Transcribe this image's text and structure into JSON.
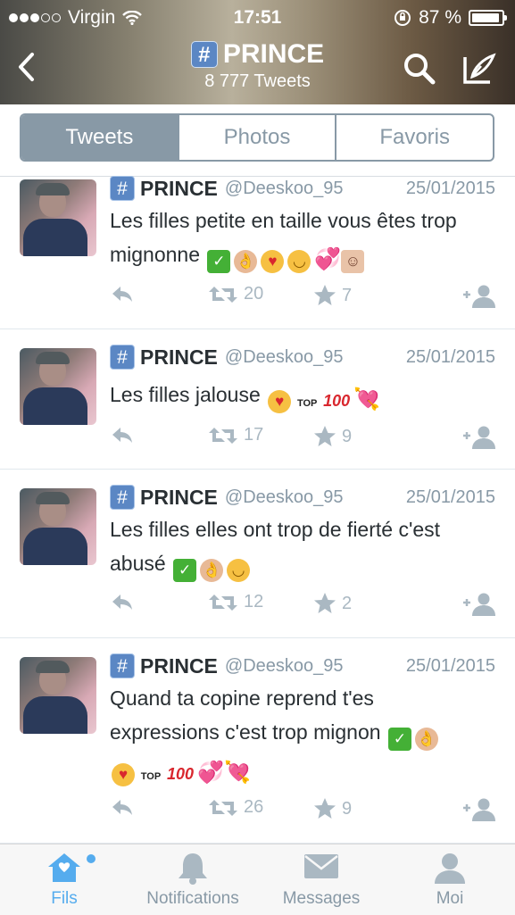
{
  "status_bar": {
    "carrier": "Virgin",
    "time": "17:51",
    "battery": "87 %"
  },
  "header": {
    "title": "PRINCE",
    "hashtag_symbol": "#",
    "subtitle": "8 777 Tweets"
  },
  "segments": [
    {
      "label": "Tweets",
      "active": true
    },
    {
      "label": "Photos",
      "active": false
    },
    {
      "label": "Favoris",
      "active": false
    }
  ],
  "tweets": [
    {
      "name": "PRINCE",
      "handle": "@Deeskoo_95",
      "date": "25/01/2015",
      "text_line1": "Les filles petite en taille vous êtes trop",
      "text_line2": "mignonne",
      "emoji": [
        "check",
        "ok-hand",
        "heart-eyes",
        "relieved",
        "two-hearts",
        "couple"
      ],
      "retweets": "20",
      "favorites": "7"
    },
    {
      "name": "PRINCE",
      "handle": "@Deeskoo_95",
      "date": "25/01/2015",
      "text_line1": "Les filles jalouse",
      "emoji": [
        "heart-eyes",
        "top",
        "hundred",
        "heart-arrow"
      ],
      "retweets": "17",
      "favorites": "9"
    },
    {
      "name": "PRINCE",
      "handle": "@Deeskoo_95",
      "date": "25/01/2015",
      "text_line1": "Les filles elles ont trop de fierté c'est",
      "text_line2": "abusé",
      "emoji": [
        "check",
        "ok-hand",
        "smirk"
      ],
      "retweets": "12",
      "favorites": "2"
    },
    {
      "name": "PRINCE",
      "handle": "@Deeskoo_95",
      "date": "25/01/2015",
      "text_line1": "Quand ta copine reprend t'es",
      "text_line2": "expressions c'est trop mignon",
      "emoji": [
        "check",
        "ok-hand",
        "heart-eyes",
        "top",
        "hundred",
        "two-hearts",
        "heart-arrow"
      ],
      "retweets": "26",
      "favorites": "9"
    }
  ],
  "emoji_glyphs": {
    "check": "✓",
    "top": "TOP",
    "hundred": "100",
    "hearts": "💞",
    "arrow_heart": "💘"
  },
  "tabbar": [
    {
      "label": "Fils",
      "icon": "home-icon",
      "active": true
    },
    {
      "label": "Notifications",
      "icon": "bell-icon",
      "active": false
    },
    {
      "label": "Messages",
      "icon": "envelope-icon",
      "active": false
    },
    {
      "label": "Moi",
      "icon": "person-icon",
      "active": false
    }
  ],
  "colors": {
    "accent": "#55acee",
    "segment": "#8899a6",
    "hashtag_badge": "#5b87c4"
  }
}
